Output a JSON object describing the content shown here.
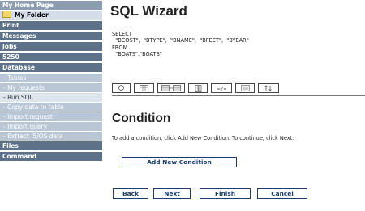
{
  "sidebar": {
    "items": [
      {
        "label": "My Home Page"
      },
      {
        "label": "My Folder"
      },
      {
        "label": "Print"
      },
      {
        "label": "Messages"
      },
      {
        "label": "Jobs"
      },
      {
        "label": "5250"
      },
      {
        "label": "Database"
      },
      {
        "label": "- Tables"
      },
      {
        "label": "- My requests"
      },
      {
        "label": "- Run SQL"
      },
      {
        "label": "- Copy data to table"
      },
      {
        "label": "- Import request"
      },
      {
        "label": "- Import query"
      },
      {
        "label": "- Extract i5/OS data"
      },
      {
        "label": "Files"
      },
      {
        "label": "Command"
      }
    ]
  },
  "main": {
    "title": "SQL Wizard",
    "sql_lines": [
      "SELECT",
      "  \"BCOST\",  \"BTYPE\",  \"BNAME\",  \"BFEET\",  \"BYEAR\"",
      "FROM",
      "  \"BOATS\".\"BOATS\""
    ],
    "tabs": [
      {
        "icon": "lightbulb-icon"
      },
      {
        "icon": "table-icon"
      },
      {
        "icon": "join-tables-icon"
      },
      {
        "icon": "column-select-icon"
      },
      {
        "icon": "condition-icon"
      },
      {
        "icon": "group-icon"
      },
      {
        "icon": "sort-icon"
      }
    ],
    "section_title": "Condition",
    "instructions": "To add a condition, click Add New Condition. To continue, click Next.",
    "add_condition_label": "Add New Condition",
    "buttons": {
      "back": "Back",
      "next": "Next",
      "finish": "Finish",
      "cancel": "Cancel"
    }
  }
}
